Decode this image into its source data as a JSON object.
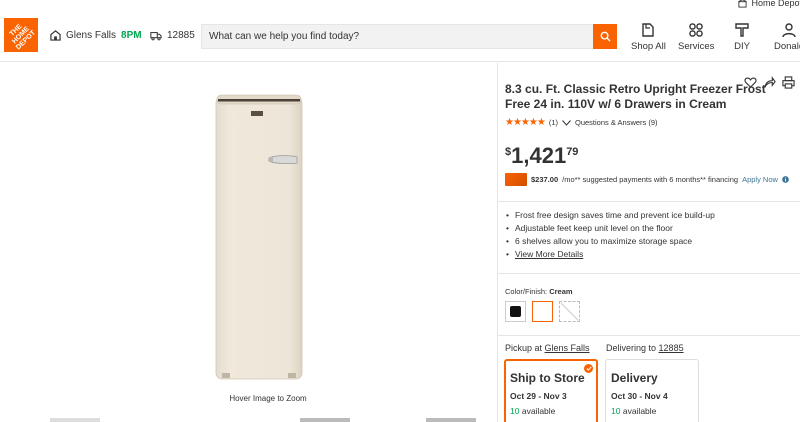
{
  "utility": {
    "home_depot_link": "Home Depot"
  },
  "header": {
    "logo_text": "THE\nHOME\nDEPOT",
    "store_name": "Glens Falls",
    "store_hours": "8PM",
    "delivery_zip": "12885",
    "search_placeholder": "What can we help you find today?",
    "nav": [
      {
        "label": "Shop All",
        "icon": "shop-all-icon"
      },
      {
        "label": "Services",
        "icon": "services-icon"
      },
      {
        "label": "DIY",
        "icon": "diy-icon"
      },
      {
        "label": "Donald",
        "icon": "account-icon"
      }
    ]
  },
  "gallery": {
    "hover_caption": "Hover Image to Zoom"
  },
  "product": {
    "title": "8.3 cu. Ft. Classic Retro Upright Freezer Frost Free 24 in. 110V w/ 6 Drawers in Cream",
    "rating": 5,
    "stars": "★★★★★",
    "review_count": "(1)",
    "qa": "Questions & Answers (9)",
    "price_symbol": "$",
    "price_dollars": "1,421",
    "price_cents": "79",
    "finance_amount": "$237.00",
    "finance_text": "/mo** suggested payments with 6 months** financing",
    "finance_apply": "Apply Now",
    "bullets": [
      "Frost free design saves time and prevent ice build-up",
      "Adjustable feet keep unit level on the floor",
      "6 shelves allow you to maximize storage space"
    ],
    "view_more": "View More Details",
    "color_label": "Color/Finish:",
    "color_value": "Cream",
    "swatch_colors": [
      "#111111",
      "#ffffff",
      "#ffffff"
    ],
    "accent_color": "#f96302"
  },
  "fulfillment": {
    "pickup_label": "Pickup at",
    "pickup_store": "Glens Falls",
    "delivering_label": "Delivering to",
    "delivering_zip": "12885",
    "ship": {
      "title": "Ship to Store",
      "dates": "Oct 29 - Nov 3",
      "count": "10",
      "suffix": "available"
    },
    "delivery": {
      "title": "Delivery",
      "dates": "Oct 30 - Nov 4",
      "count": "10",
      "suffix": "available"
    }
  }
}
